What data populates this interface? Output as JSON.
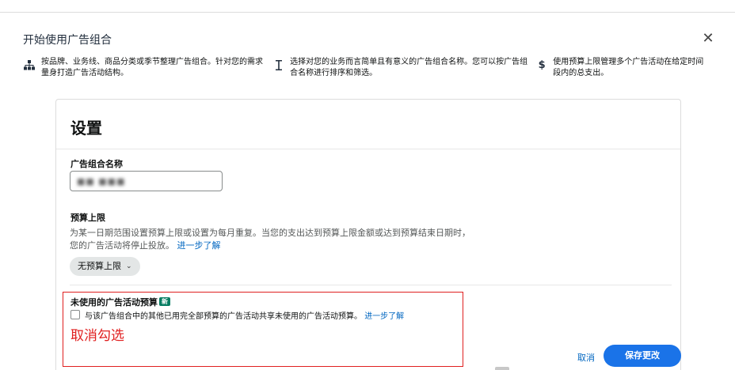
{
  "dialog": {
    "title": "开始使用广告组合",
    "close_icon": "close-icon"
  },
  "tips": [
    {
      "icon": "org-chart-icon",
      "text": "按品牌、业务线、商品分类或季节整理广告组合。针对您的需求量身打造广告活动结构。"
    },
    {
      "icon": "text-cursor-icon",
      "text": "选择对您的业务而言简单且有意义的广告组合名称。您可以按广告组合名称进行排序和筛选。"
    },
    {
      "icon": "dollar-icon",
      "text": "使用预算上限管理多个广告活动在给定时间段内的总支出。"
    }
  ],
  "settings": {
    "title": "设置",
    "name_label": "广告组合名称",
    "name_value": "■■ ■■■",
    "budget_label": "预算上限",
    "budget_desc": "为某一日期范围设置预算上限或设置为每月重复。当您的支出达到预算上限金额或达到预算结束日期时，您的广告活动将停止投放。",
    "budget_link": "进一步了解",
    "budget_select": "无预算上限",
    "unused_label": "未使用的广告活动预算",
    "badge": "新",
    "checkbox_text": "与该广告组合中的其他已用完全部预算的广告活动共享未使用的广告活动预算。",
    "checkbox_link": "进一步了解",
    "checkbox_checked": false
  },
  "annotation": {
    "text": "取消勾选",
    "color": "#e02020"
  },
  "footer": {
    "cancel_label": "取消",
    "save_label": "保存更改"
  },
  "colors": {
    "primary_button": "#1a73e8",
    "link": "#0066c0",
    "badge": "#067d62"
  }
}
